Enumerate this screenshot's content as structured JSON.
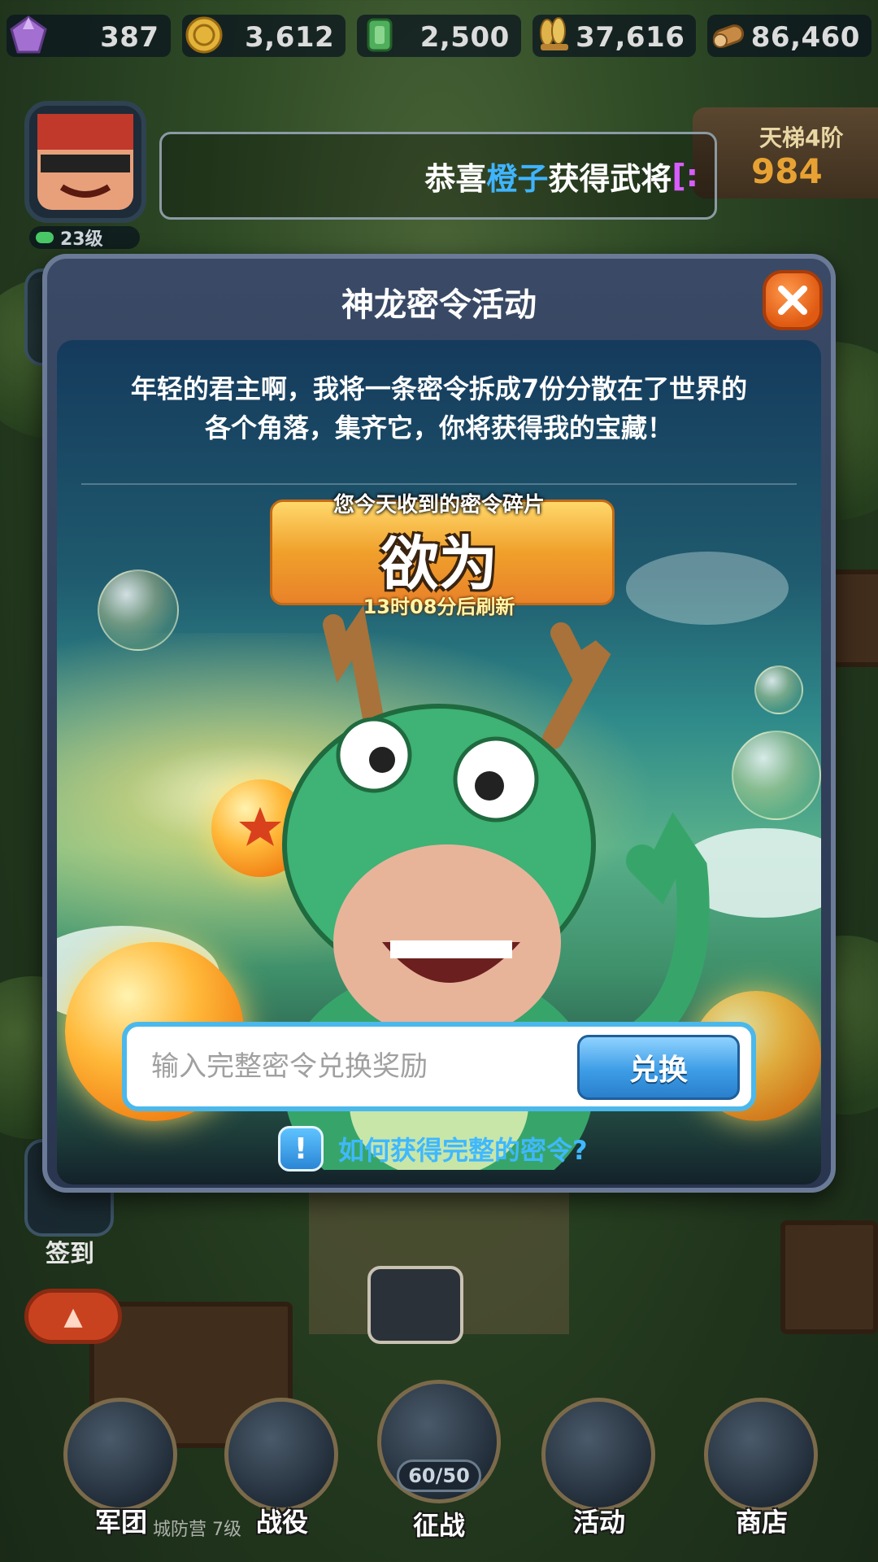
{
  "resources": [
    {
      "name": "gem-icon",
      "value": "387",
      "color": "#b07ad6"
    },
    {
      "name": "coin-icon",
      "value": "3,612",
      "color": "#e4b33a"
    },
    {
      "name": "jade-icon",
      "value": "2,500",
      "color": "#4fae5b"
    },
    {
      "name": "grain-icon",
      "value": "37,616",
      "color": "#d9a63b"
    },
    {
      "name": "wood-icon",
      "value": "86,460",
      "color": "#c78a45"
    }
  ],
  "player": {
    "level": "23级"
  },
  "marquee": {
    "prefix": "恭喜",
    "name": "橙子",
    "suffix": "获得武将",
    "bracket": "[:"
  },
  "rank": {
    "title": "天梯4阶",
    "value": "984"
  },
  "sidebar": {
    "sign_in": "签到"
  },
  "modal": {
    "title": "神龙密令活动",
    "intro_line1": "年轻的君主啊，我将一条密令拆成7份分散在了世界的",
    "intro_line2": "各个角落，集齐它，你将获得我的宝藏！",
    "fragment_caption": "您今天收到的密令碎片",
    "fragment": "欲为",
    "refresh": "13时08分后刷新",
    "input_placeholder": "输入完整密令兑换奖励",
    "redeem_button": "兑换",
    "help_icon": "!",
    "help_text": "如何获得完整的密令?"
  },
  "nav": {
    "legion": "军团",
    "campaign": "战役",
    "expedition": "征战",
    "stamina": "60/50",
    "events": "活动",
    "shop": "商店",
    "fort_label": "城防营 7级"
  },
  "colors": {
    "accent_blue": "#3fb8ff",
    "close_orange": "#e05a12",
    "fragment_gold": "#f0a02b"
  }
}
